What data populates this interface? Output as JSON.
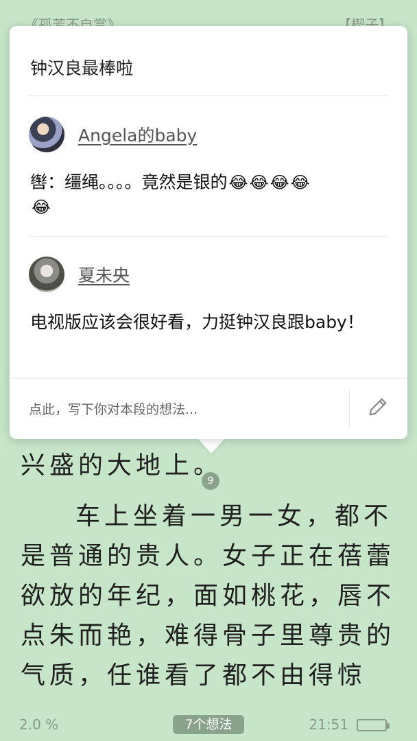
{
  "header": {
    "book_title": "《孤芳不自赏》",
    "author": "【楔子】"
  },
  "popup": {
    "quote": "钟汉良最棒啦",
    "comments": [
      {
        "name": "Angela的baby",
        "text": "辔：缰绳。。。。竟然是银的",
        "emoji": [
          "😂",
          "😂",
          "😂",
          "😂",
          "😂"
        ]
      },
      {
        "name": "夏未央",
        "text": "电视版应该会很好看，力挺钟汉良跟baby！"
      }
    ],
    "input_placeholder": "点此，写下你对本段的想法...",
    "edit_icon": "pencil-icon"
  },
  "reading": {
    "line_end": "兴盛的大地上。",
    "paragraph_badge": "9",
    "paragraph": "车上坐着一男一女，都不是普通的贵人。女子正在蓓蕾欲放的年纪，面如桃花，唇不点朱而艳，难得骨子里尊贵的气质，任谁看了都不由得惊"
  },
  "footer": {
    "progress": "2.0 %",
    "thoughts_button": "7个想法",
    "time": "21:51"
  },
  "colors": {
    "background": "#c7e5c9",
    "accent": "#8aa38c"
  }
}
